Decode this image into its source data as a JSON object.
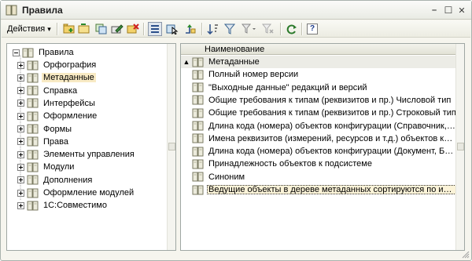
{
  "window": {
    "title": "Правила",
    "controls": {
      "close": "✕",
      "maximize": "☐",
      "minimize": "–"
    }
  },
  "toolbar": {
    "actions_label": "Действия",
    "actions_arrow": "▾",
    "help_label": "?"
  },
  "tree": {
    "root": "Правила",
    "items": [
      {
        "label": "Орфография",
        "selected": false
      },
      {
        "label": "Метаданные",
        "selected": true
      },
      {
        "label": "Справка",
        "selected": false
      },
      {
        "label": "Интерфейсы",
        "selected": false
      },
      {
        "label": "Оформление",
        "selected": false
      },
      {
        "label": "Формы",
        "selected": false
      },
      {
        "label": "Права",
        "selected": false
      },
      {
        "label": "Элементы управления",
        "selected": false
      },
      {
        "label": "Модули",
        "selected": false
      },
      {
        "label": "Дополнения",
        "selected": false
      },
      {
        "label": "Оформление модулей",
        "selected": false
      },
      {
        "label": "1С:Совместимо",
        "selected": false
      }
    ]
  },
  "grid": {
    "column_header": "Наименование",
    "rows": [
      "Метаданные",
      "Полный номер версии",
      "\"Выходные данные\" редакций и версий",
      "Общие требования к типам (реквизитов и пр.) Числовой тип",
      "Общие требования к типам (реквизитов и пр.) Строковый тип",
      "Длина кода (номера) объектов конфигурации (Справочник, П...",
      "Имена реквизитов (измерений, ресурсов и т.д.) объектов кон...",
      "Длина кода (номера) объектов конфигурации (Документ, Биз...",
      "Принадлежность  объектов к подсистеме",
      "Синоним",
      "Ведущие объекты в дереве метаданных сортируются по имен..."
    ],
    "first_row_marker": "▲"
  }
}
